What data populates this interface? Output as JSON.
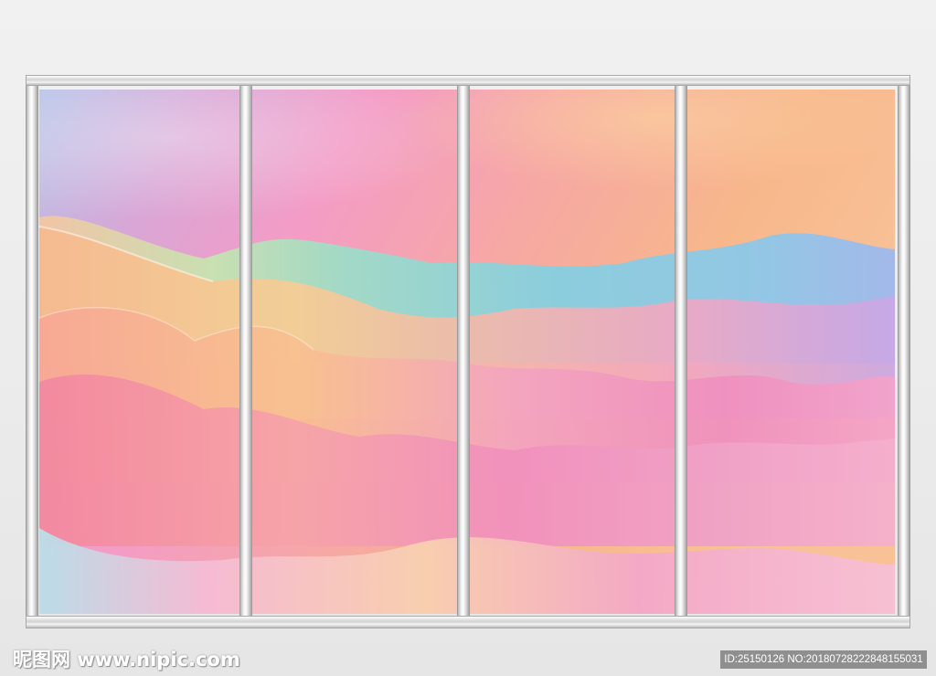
{
  "watermark": {
    "site_text": "昵图网 www.nipic.com",
    "id_text": "ID:25150126 NO:20180728222848155031"
  },
  "colors": {
    "frame": "#d8d8d8",
    "background": "#ededed",
    "sky_left": "#b7c6e6",
    "sky_pink": "#f2a3c7",
    "sky_peach": "#f6b88e",
    "hill_cyan": "#8fd2dd",
    "hill_peach": "#f7c49a",
    "hill_pink": "#f19ac0"
  },
  "artwork": {
    "panel_count": 4,
    "subject": "pastel-gradient-mountain-waves"
  }
}
